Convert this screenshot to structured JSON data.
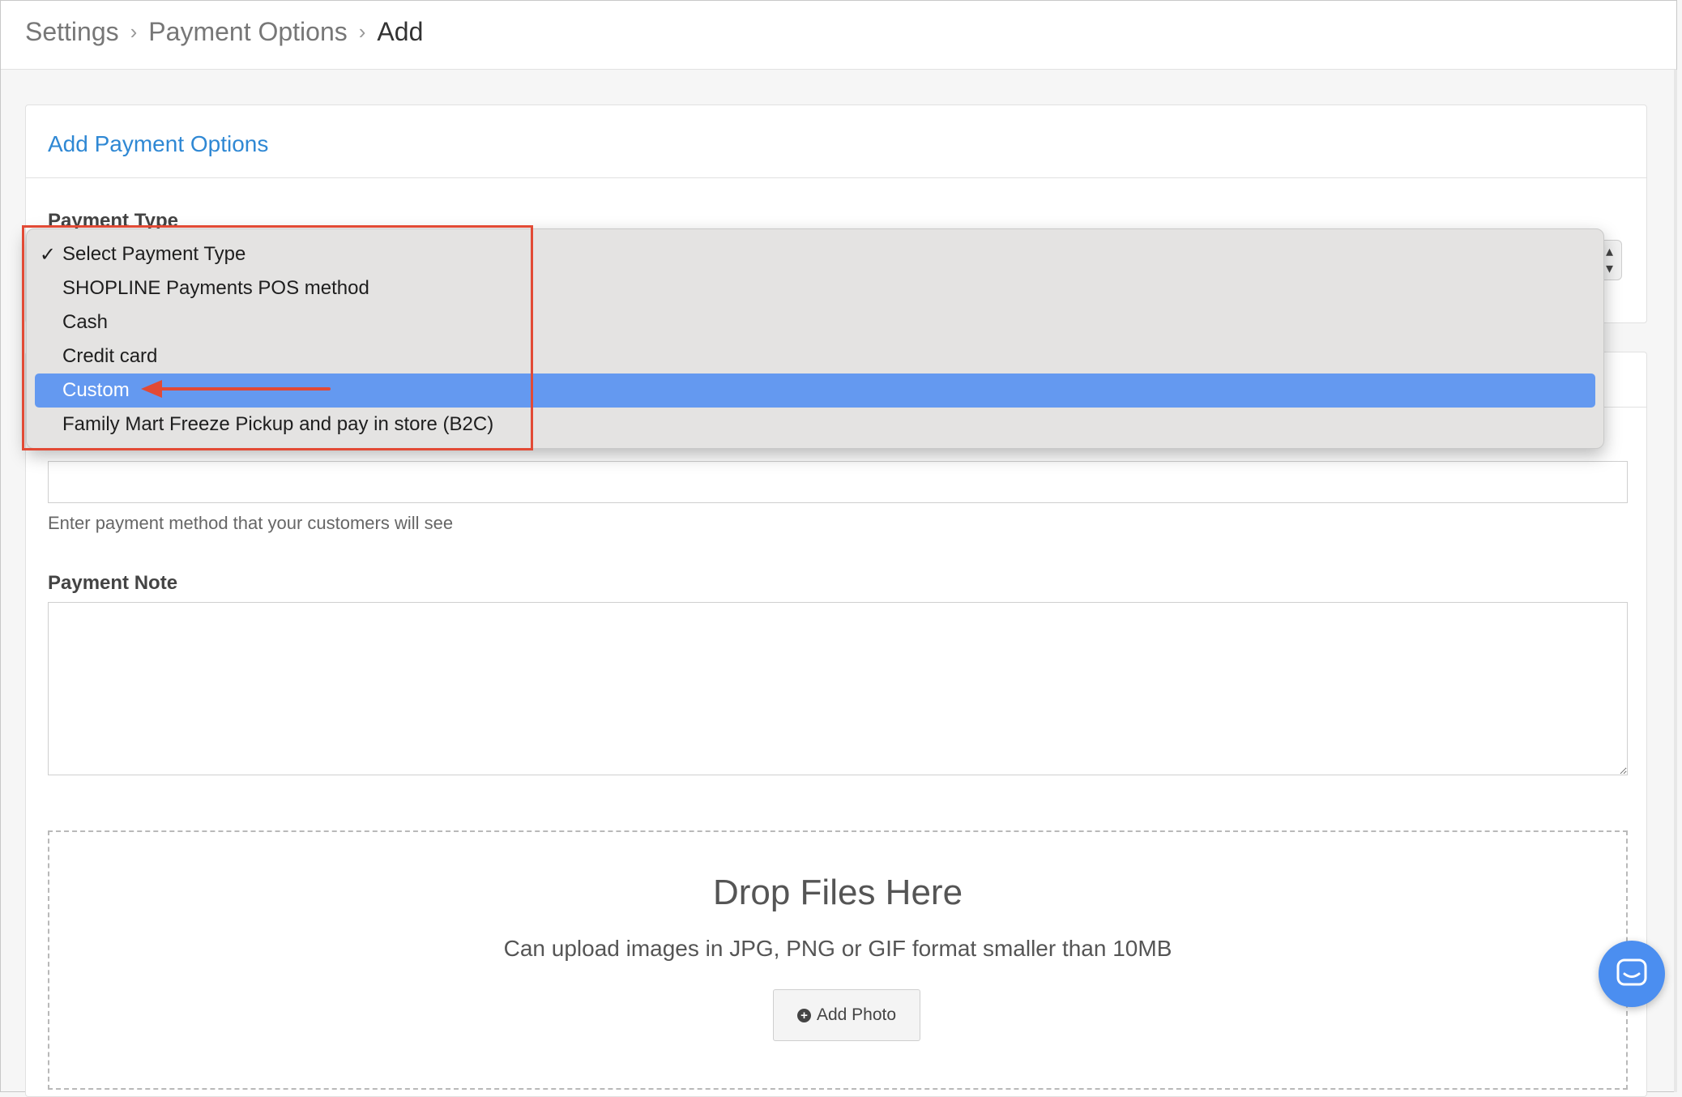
{
  "breadcrumb": {
    "items": [
      "Settings",
      "Payment Options"
    ],
    "current": "Add"
  },
  "card": {
    "title": "Add Payment Options",
    "payment_type_label": "Payment Type"
  },
  "dropdown": {
    "options": [
      {
        "label": "Select Payment Type",
        "checked": true
      },
      {
        "label": "SHOPLINE Payments POS method"
      },
      {
        "label": "Cash"
      },
      {
        "label": "Credit card"
      },
      {
        "label": "Custom",
        "highlighted": true
      },
      {
        "label": "Family Mart Freeze Pickup and pay in store (B2C)"
      }
    ],
    "check_mark": "✓"
  },
  "form": {
    "payment_name_value": "",
    "payment_name_help": "Enter payment method that your customers will see",
    "payment_note_label": "Payment Note",
    "payment_note_value": ""
  },
  "upload": {
    "title": "Drop Files Here",
    "subtitle": "Can upload images in JPG, PNG or GIF format smaller than 10MB",
    "button_label": "Add Photo"
  },
  "colors": {
    "accent": "#2f88d4",
    "highlight": "#6499f0",
    "annotation": "#e24a35",
    "chat": "#4b8ef0"
  },
  "icons": {
    "chevron": "chevron-right-icon",
    "select_arrows": "sort-arrows-icon",
    "add_photo": "plus-circle-icon",
    "chat": "chat-bubble-icon"
  }
}
